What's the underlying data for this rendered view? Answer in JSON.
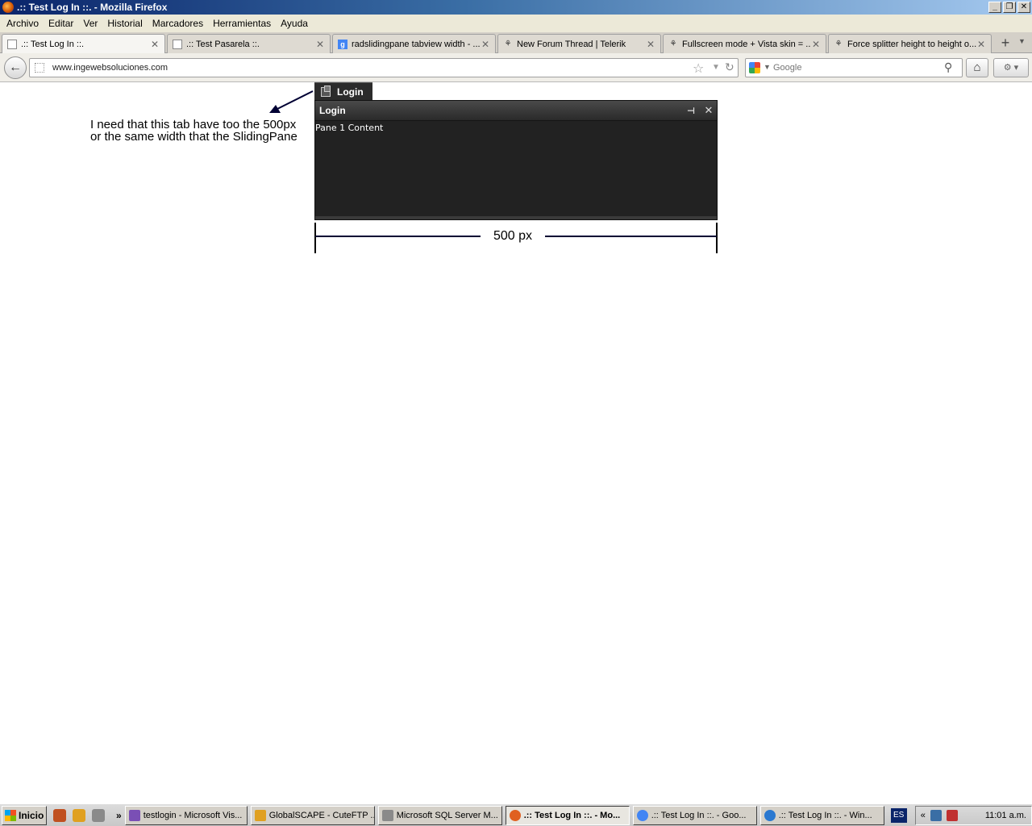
{
  "window": {
    "title": ".:: Test Log In ::. - Mozilla Firefox",
    "buttons": {
      "minimize": "_",
      "restore": "❐",
      "close": "✕"
    }
  },
  "menu": [
    "Archivo",
    "Editar",
    "Ver",
    "Historial",
    "Marcadores",
    "Herramientas",
    "Ayuda"
  ],
  "tabs": [
    {
      "label": ".:: Test Log In ::.",
      "icon": "page-icon",
      "active": true
    },
    {
      "label": ".:: Test Pasarela ::.",
      "icon": "page-icon",
      "active": false
    },
    {
      "label": "radslidingpane tabview width - ...",
      "icon": "google-icon",
      "active": false
    },
    {
      "label": "New Forum Thread | Telerik",
      "icon": "telerik-icon",
      "active": false
    },
    {
      "label": "Fullscreen mode + Vista skin = ...",
      "icon": "telerik-icon",
      "active": false
    },
    {
      "label": "Force splitter height to height o...",
      "icon": "telerik-icon",
      "active": false
    }
  ],
  "nav": {
    "url": "www.ingewebsoluciones.com",
    "search_placeholder": "Google"
  },
  "page": {
    "annotation": "I need that this tab have too the 500px or the same width that the SlidingPane",
    "sliding_tab_label": "Login",
    "pane_title": "Login",
    "pane_content": "Pane 1 Content",
    "dimension_label": "500 px"
  },
  "taskbar": {
    "start_label": "Inicio",
    "tasks": [
      {
        "label": "testlogin - Microsoft Vis...",
        "active": false,
        "color": "#7a4fb5"
      },
      {
        "label": "GlobalSCAPE - CuteFTP ...",
        "active": false,
        "color": "#e0a020"
      },
      {
        "label": "Microsoft SQL Server M...",
        "active": false,
        "color": "#8a8a8a"
      },
      {
        "label": ".:: Test Log In ::. - Mo...",
        "active": true,
        "color": "#e06020"
      },
      {
        "label": ".:: Test Log In ::. - Goo...",
        "active": false,
        "color": "#4285f4"
      },
      {
        "label": ".:: Test Log In ::. - Win...",
        "active": false,
        "color": "#2a78d0"
      }
    ],
    "language": "ES",
    "tray_chevron": "«",
    "clock": "11:01 a.m."
  }
}
